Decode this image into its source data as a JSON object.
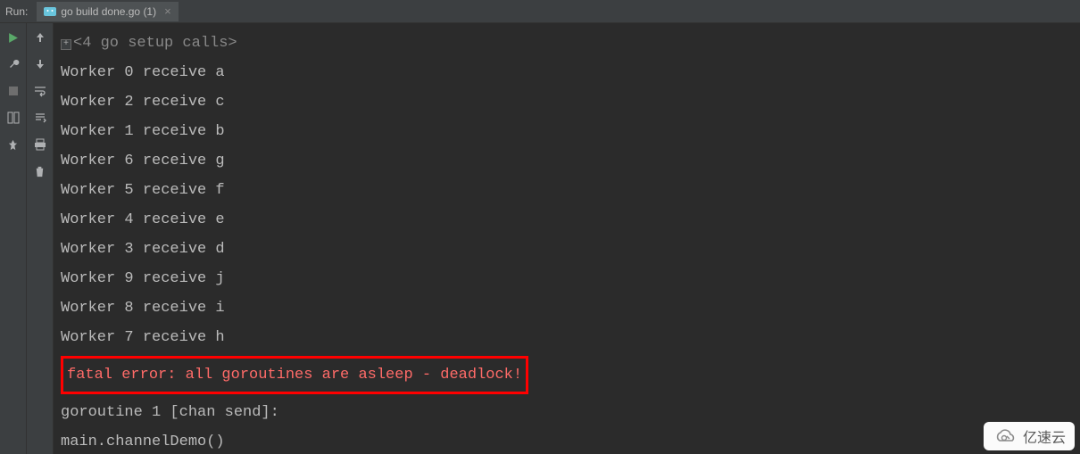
{
  "header": {
    "run_label": "Run:",
    "tab_title": "go build done.go (1)"
  },
  "console": {
    "setup_line": "<4 go setup calls>",
    "lines": [
      "Worker 0 receive a",
      "Worker 2 receive c",
      "Worker 1 receive b",
      "Worker 6 receive g",
      "Worker 5 receive f",
      "Worker 4 receive e",
      "Worker 3 receive d",
      "Worker 9 receive j",
      "Worker 8 receive i",
      "Worker 7 receive h"
    ],
    "error_line": "fatal error: all goroutines are asleep - deadlock!",
    "after_lines": [
      "",
      "goroutine 1 [chan send]:",
      "main.channelDemo()"
    ]
  },
  "watermark": {
    "text": "亿速云"
  }
}
